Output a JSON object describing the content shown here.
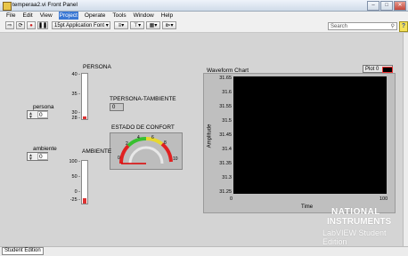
{
  "window": {
    "title": "temperaa2.vi Front Panel"
  },
  "menubar": {
    "items": [
      "File",
      "Edit",
      "View",
      "Project",
      "Operate",
      "Tools",
      "Window",
      "Help"
    ]
  },
  "toolbar": {
    "font_label": "15pt Application Font",
    "search_placeholder": "Search",
    "help_glyph": "?"
  },
  "controls": {
    "persona_label": "persona",
    "persona_value": "0",
    "ambiente_label": "ambiente",
    "ambiente_value": "0"
  },
  "thermometers": {
    "persona": {
      "label": "PERSONA",
      "ticks": [
        "40 -",
        "35 -",
        "30 -",
        "28 -"
      ],
      "fill_fraction": 0.06
    },
    "ambiente": {
      "label": "AMBIENTE",
      "ticks": [
        "100 -",
        "50 -",
        "0 -",
        "-25 -"
      ],
      "fill_fraction": 0.12
    }
  },
  "indicator": {
    "label": "TPERSONA-TAMBIENTE",
    "value": "0"
  },
  "gauge": {
    "label": "ESTADO DE CONFORT",
    "ticks": [
      "0",
      "2",
      "4",
      "6",
      "8",
      "10"
    ],
    "value": 0
  },
  "chart": {
    "title": "Waveform Chart",
    "legend": "Plot 0"
  },
  "chart_data": {
    "type": "line",
    "title": "Waveform Chart",
    "xlabel": "Time",
    "ylabel": "Amplitude",
    "xlim": [
      0,
      100
    ],
    "ylim": [
      31.25,
      31.65
    ],
    "y_ticks": [
      "31.65",
      "31.6",
      "31.55",
      "31.5",
      "31.45",
      "31.4",
      "31.35",
      "31.3",
      "31.25"
    ],
    "x_ticks": [
      "0",
      "100"
    ],
    "series": [
      {
        "name": "Plot 0",
        "values": []
      }
    ],
    "grid": false
  },
  "watermark": {
    "line1": "NATIONAL",
    "line2": "INSTRUMENTS",
    "line3": "LabVIEW Student Edition"
  },
  "statusbar": {
    "tab": "Student Edition"
  }
}
